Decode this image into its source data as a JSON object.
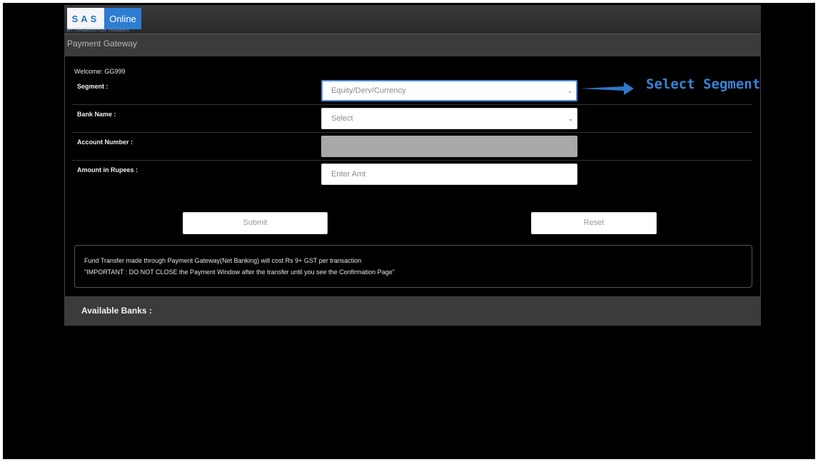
{
  "logo": {
    "part1": "SAS",
    "part2": "Online",
    "tagline": "BY TRADERS FOR TRADERS"
  },
  "page_title": "Payment Gateway",
  "welcome": "Welcome: GG999",
  "form": {
    "segment": {
      "label": "Segment :",
      "value": "Equity/Derv/Currency"
    },
    "bank_name": {
      "label": "Bank Name :",
      "value": "Select"
    },
    "account_number": {
      "label": "Account Number :",
      "value": ""
    },
    "amount": {
      "label": "Amount in Rupees :",
      "placeholder": "Enter Amt"
    }
  },
  "buttons": {
    "submit": "Submit",
    "reset": "Reset"
  },
  "notice": {
    "line1": "Fund Transfer made through Payment Gateway(Net Banking) will cost Rs 9+ GST per transaction",
    "line2": "\"IMPORTANT : DO NOT CLOSE the Payment Window after the transfer until you see the Confirmation Page\""
  },
  "available_banks": "Available Banks :",
  "annotation": {
    "text": "Select Segment",
    "color": "#3a84d6"
  },
  "icons": {
    "dropdown": "chevron-down-icon",
    "arrow": "arrow-right-icon"
  }
}
